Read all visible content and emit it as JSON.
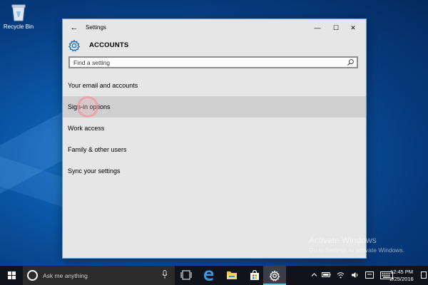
{
  "desktop": {
    "recycle_bin_label": "Recycle Bin"
  },
  "window": {
    "title": "Settings",
    "section_title": "ACCOUNTS",
    "controls": {
      "minimize": "—",
      "maximize": "☐",
      "close": "✕"
    },
    "back_glyph": "←",
    "search": {
      "placeholder": "Find a setting",
      "value": ""
    },
    "nav_items": [
      {
        "label": "Your email and accounts",
        "selected": false
      },
      {
        "label": "Sign-in options",
        "selected": true
      },
      {
        "label": "Work access",
        "selected": false
      },
      {
        "label": "Family & other users",
        "selected": false
      },
      {
        "label": "Sync your settings",
        "selected": false
      }
    ]
  },
  "watermark": {
    "line1": "Activate Windows",
    "line2": "Go to Settings to activate Windows."
  },
  "taskbar": {
    "search_placeholder": "Ask me anything",
    "pinned": [
      "task-view-icon",
      "edge-icon",
      "file-explorer-icon",
      "store-icon",
      "settings-icon"
    ],
    "active_app": "settings-icon",
    "clock": {
      "time": "12:45 PM",
      "date": "2/25/2016"
    },
    "accent_color": "#76b9ed"
  },
  "colors": {
    "window_bg": "#e6e6e6",
    "selected_row": "#cfcfcf",
    "accent": "#1a6fb5",
    "taskbar": "#101319"
  }
}
